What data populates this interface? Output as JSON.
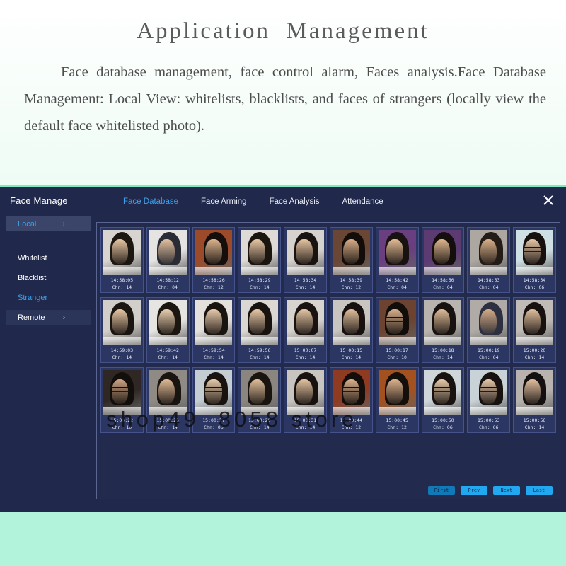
{
  "promo": {
    "title": "Application  Management",
    "body": "Face database management, face control alarm, Faces analysis.Face Database Management: Local View: whitelists, blacklists, and faces of strangers (locally view the default face whitelisted photo)."
  },
  "watermark": "shop49  8058 store",
  "window": {
    "title": "Face Manage",
    "close_icon": "close-icon",
    "tabs": [
      {
        "label": "Face Database",
        "active": true
      },
      {
        "label": "Face Arming",
        "active": false
      },
      {
        "label": "Face Analysis",
        "active": false
      },
      {
        "label": "Attendance",
        "active": false
      }
    ],
    "sidebar": [
      {
        "label": "Local",
        "arrow": "›",
        "state": "selected"
      },
      {
        "label": "Whitelist",
        "arrow": "",
        "state": "normal"
      },
      {
        "label": "Blacklist",
        "arrow": "",
        "state": "normal"
      },
      {
        "label": "Stranger",
        "arrow": "",
        "state": "accent"
      },
      {
        "label": "Remote",
        "arrow": "›",
        "state": "remote"
      }
    ],
    "pagination": [
      {
        "label": "First",
        "current": true
      },
      {
        "label": "Prev",
        "current": false
      },
      {
        "label": "Next",
        "current": false
      },
      {
        "label": "Last",
        "current": false
      }
    ]
  },
  "colors": {
    "window_bg": "#20294b",
    "content_bg": "#222b4e",
    "cell_bg": "#2b3663",
    "accent": "#3ea0ea",
    "page_btn": "#21a8f0",
    "page_btn_active": "#1179b8",
    "top_border": "#7fe8c4"
  },
  "faces": {
    "rows": [
      [
        {
          "time": "14:58:05",
          "chn": "Chn: 14",
          "wall": "#d8d4cf",
          "hair": "#1d1712",
          "skin": "#e8c6a4"
        },
        {
          "time": "14:58:12",
          "chn": "Chn: 04",
          "wall": "#e6e4e2",
          "hair": "#2a2c35",
          "skin": "#e2c1a0"
        },
        {
          "time": "14:58:26",
          "chn": "Chn: 12",
          "wall": "#9c4b2a",
          "hair": "#140f0c",
          "skin": "#dcb48e"
        },
        {
          "time": "14:58:29",
          "chn": "Chn: 14",
          "wall": "#dedad6",
          "hair": "#1b1510",
          "skin": "#e9c8a6"
        },
        {
          "time": "14:58:34",
          "chn": "Chn: 14",
          "wall": "#d6d2ce",
          "hair": "#181310",
          "skin": "#e7c5a2"
        },
        {
          "time": "14:58:39",
          "chn": "Chn: 12",
          "wall": "#6a4634",
          "hair": "#120d0a",
          "skin": "#d9ae88"
        },
        {
          "time": "14:58:42",
          "chn": "Chn: 04",
          "wall": "#6a3f80",
          "hair": "#181210",
          "skin": "#e3bb95"
        },
        {
          "time": "14:58:50",
          "chn": "Chn: 04",
          "wall": "#5c3a72",
          "hair": "#140f0d",
          "skin": "#dfb78f"
        },
        {
          "time": "14:58:53",
          "chn": "Chn: 04",
          "wall": "#ada7a2",
          "hair": "#241c16",
          "skin": "#d9b08a"
        },
        {
          "time": "14:58:54",
          "chn": "Chn: 06",
          "wall": "#cfe0e4",
          "hair": "#16110e",
          "skin": "#e6c6a6",
          "glasses": true
        }
      ],
      [
        {
          "time": "14:59:03",
          "chn": "Chn: 14",
          "wall": "#d2cec9",
          "hair": "#1a1510",
          "skin": "#e8c7a5"
        },
        {
          "time": "14:59:42",
          "chn": "Chn: 14",
          "wall": "#e7e5e2",
          "hair": "#1c1611",
          "skin": "#ead0b0"
        },
        {
          "time": "14:59:54",
          "chn": "Chn: 14",
          "wall": "#e4e1dd",
          "hair": "#1a1410",
          "skin": "#e9cbab"
        },
        {
          "time": "14:59:56",
          "chn": "Chn: 14",
          "wall": "#dbd8d4",
          "hair": "#191310",
          "skin": "#e8c9a8"
        },
        {
          "time": "15:00:07",
          "chn": "Chn: 14",
          "wall": "#d7d3cf",
          "hair": "#181310",
          "skin": "#e6c6a5"
        },
        {
          "time": "15:00:15",
          "chn": "Chn: 14",
          "wall": "#c9c5c0",
          "hair": "#161110",
          "skin": "#e0bf9c"
        },
        {
          "time": "15:00:17",
          "chn": "Chn: 10",
          "wall": "#6b4330",
          "hair": "#110d0b",
          "skin": "#d8b08d",
          "glasses": true
        },
        {
          "time": "15:00:18",
          "chn": "Chn: 14",
          "wall": "#b9b4af",
          "hair": "#171210",
          "skin": "#e0bd99"
        },
        {
          "time": "15:00:19",
          "chn": "Chn: 04",
          "wall": "#b0aba6",
          "hair": "#2c3040",
          "skin": "#d5ab85"
        },
        {
          "time": "15:00:20",
          "chn": "Chn: 14",
          "wall": "#c0bbb6",
          "hair": "#171210",
          "skin": "#e2c09e"
        }
      ],
      [
        {
          "time": "15:00:22",
          "chn": "Chn: 10",
          "wall": "#2f2723",
          "hair": "#120e0c",
          "skin": "#cfa584",
          "glasses": true
        },
        {
          "time": "15:00:25",
          "chn": "Chn: 14",
          "wall": "#8f8a84",
          "hair": "#1a1411",
          "skin": "#e0bb96"
        },
        {
          "time": "15:00:27",
          "chn": "Chn: 06",
          "wall": "#c3cdd2",
          "hair": "#191310",
          "skin": "#e8cbaa",
          "glasses": true
        },
        {
          "time": "15:00:28",
          "chn": "Chn: 14",
          "wall": "#8a857f",
          "hair": "#191410",
          "skin": "#e1bf9b"
        },
        {
          "time": "15:00:31",
          "chn": "Chn: 14",
          "wall": "#c8c4bf",
          "hair": "#171210",
          "skin": "#e5c4a2"
        },
        {
          "time": "15:00:44",
          "chn": "Chn: 12",
          "wall": "#8e3b22",
          "hair": "#130e0b",
          "skin": "#dcb28c",
          "glasses": true
        },
        {
          "time": "15:00:45",
          "chn": "Chn: 12",
          "wall": "#a2511f",
          "hair": "#150f0c",
          "skin": "#ddb38d"
        },
        {
          "time": "15:00:50",
          "chn": "Chn: 06",
          "wall": "#cfd6d9",
          "hair": "#181310",
          "skin": "#e9cbab",
          "glasses": true
        },
        {
          "time": "15:00:53",
          "chn": "Chn: 06",
          "wall": "#c9d2d6",
          "hair": "#171210",
          "skin": "#e7c8a8",
          "glasses": true
        },
        {
          "time": "15:00:56",
          "chn": "Chn: 14",
          "wall": "#b8b3ae",
          "hair": "#141010",
          "skin": "#e3c09e"
        }
      ]
    ]
  }
}
